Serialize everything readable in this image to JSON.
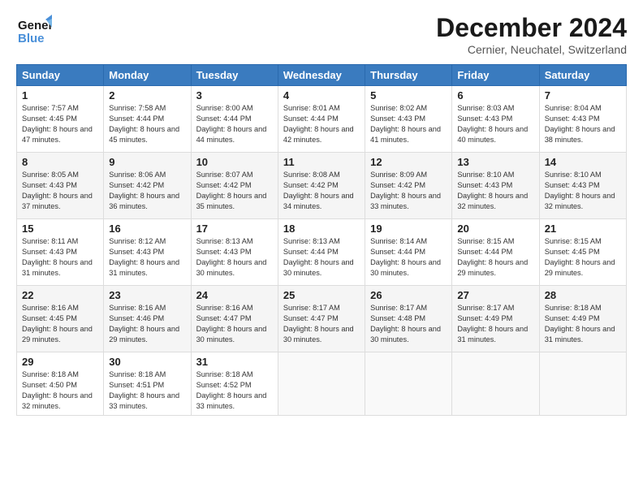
{
  "header": {
    "logo_line1": "General",
    "logo_line2": "Blue",
    "month": "December 2024",
    "location": "Cernier, Neuchatel, Switzerland"
  },
  "weekdays": [
    "Sunday",
    "Monday",
    "Tuesday",
    "Wednesday",
    "Thursday",
    "Friday",
    "Saturday"
  ],
  "weeks": [
    [
      {
        "day": "1",
        "sunrise": "7:57 AM",
        "sunset": "4:45 PM",
        "daylight": "8 hours and 47 minutes."
      },
      {
        "day": "2",
        "sunrise": "7:58 AM",
        "sunset": "4:44 PM",
        "daylight": "8 hours and 45 minutes."
      },
      {
        "day": "3",
        "sunrise": "8:00 AM",
        "sunset": "4:44 PM",
        "daylight": "8 hours and 44 minutes."
      },
      {
        "day": "4",
        "sunrise": "8:01 AM",
        "sunset": "4:44 PM",
        "daylight": "8 hours and 42 minutes."
      },
      {
        "day": "5",
        "sunrise": "8:02 AM",
        "sunset": "4:43 PM",
        "daylight": "8 hours and 41 minutes."
      },
      {
        "day": "6",
        "sunrise": "8:03 AM",
        "sunset": "4:43 PM",
        "daylight": "8 hours and 40 minutes."
      },
      {
        "day": "7",
        "sunrise": "8:04 AM",
        "sunset": "4:43 PM",
        "daylight": "8 hours and 38 minutes."
      }
    ],
    [
      {
        "day": "8",
        "sunrise": "8:05 AM",
        "sunset": "4:43 PM",
        "daylight": "8 hours and 37 minutes."
      },
      {
        "day": "9",
        "sunrise": "8:06 AM",
        "sunset": "4:42 PM",
        "daylight": "8 hours and 36 minutes."
      },
      {
        "day": "10",
        "sunrise": "8:07 AM",
        "sunset": "4:42 PM",
        "daylight": "8 hours and 35 minutes."
      },
      {
        "day": "11",
        "sunrise": "8:08 AM",
        "sunset": "4:42 PM",
        "daylight": "8 hours and 34 minutes."
      },
      {
        "day": "12",
        "sunrise": "8:09 AM",
        "sunset": "4:42 PM",
        "daylight": "8 hours and 33 minutes."
      },
      {
        "day": "13",
        "sunrise": "8:10 AM",
        "sunset": "4:43 PM",
        "daylight": "8 hours and 32 minutes."
      },
      {
        "day": "14",
        "sunrise": "8:10 AM",
        "sunset": "4:43 PM",
        "daylight": "8 hours and 32 minutes."
      }
    ],
    [
      {
        "day": "15",
        "sunrise": "8:11 AM",
        "sunset": "4:43 PM",
        "daylight": "8 hours and 31 minutes."
      },
      {
        "day": "16",
        "sunrise": "8:12 AM",
        "sunset": "4:43 PM",
        "daylight": "8 hours and 31 minutes."
      },
      {
        "day": "17",
        "sunrise": "8:13 AM",
        "sunset": "4:43 PM",
        "daylight": "8 hours and 30 minutes."
      },
      {
        "day": "18",
        "sunrise": "8:13 AM",
        "sunset": "4:44 PM",
        "daylight": "8 hours and 30 minutes."
      },
      {
        "day": "19",
        "sunrise": "8:14 AM",
        "sunset": "4:44 PM",
        "daylight": "8 hours and 30 minutes."
      },
      {
        "day": "20",
        "sunrise": "8:15 AM",
        "sunset": "4:44 PM",
        "daylight": "8 hours and 29 minutes."
      },
      {
        "day": "21",
        "sunrise": "8:15 AM",
        "sunset": "4:45 PM",
        "daylight": "8 hours and 29 minutes."
      }
    ],
    [
      {
        "day": "22",
        "sunrise": "8:16 AM",
        "sunset": "4:45 PM",
        "daylight": "8 hours and 29 minutes."
      },
      {
        "day": "23",
        "sunrise": "8:16 AM",
        "sunset": "4:46 PM",
        "daylight": "8 hours and 29 minutes."
      },
      {
        "day": "24",
        "sunrise": "8:16 AM",
        "sunset": "4:47 PM",
        "daylight": "8 hours and 30 minutes."
      },
      {
        "day": "25",
        "sunrise": "8:17 AM",
        "sunset": "4:47 PM",
        "daylight": "8 hours and 30 minutes."
      },
      {
        "day": "26",
        "sunrise": "8:17 AM",
        "sunset": "4:48 PM",
        "daylight": "8 hours and 30 minutes."
      },
      {
        "day": "27",
        "sunrise": "8:17 AM",
        "sunset": "4:49 PM",
        "daylight": "8 hours and 31 minutes."
      },
      {
        "day": "28",
        "sunrise": "8:18 AM",
        "sunset": "4:49 PM",
        "daylight": "8 hours and 31 minutes."
      }
    ],
    [
      {
        "day": "29",
        "sunrise": "8:18 AM",
        "sunset": "4:50 PM",
        "daylight": "8 hours and 32 minutes."
      },
      {
        "day": "30",
        "sunrise": "8:18 AM",
        "sunset": "4:51 PM",
        "daylight": "8 hours and 33 minutes."
      },
      {
        "day": "31",
        "sunrise": "8:18 AM",
        "sunset": "4:52 PM",
        "daylight": "8 hours and 33 minutes."
      },
      null,
      null,
      null,
      null
    ]
  ]
}
